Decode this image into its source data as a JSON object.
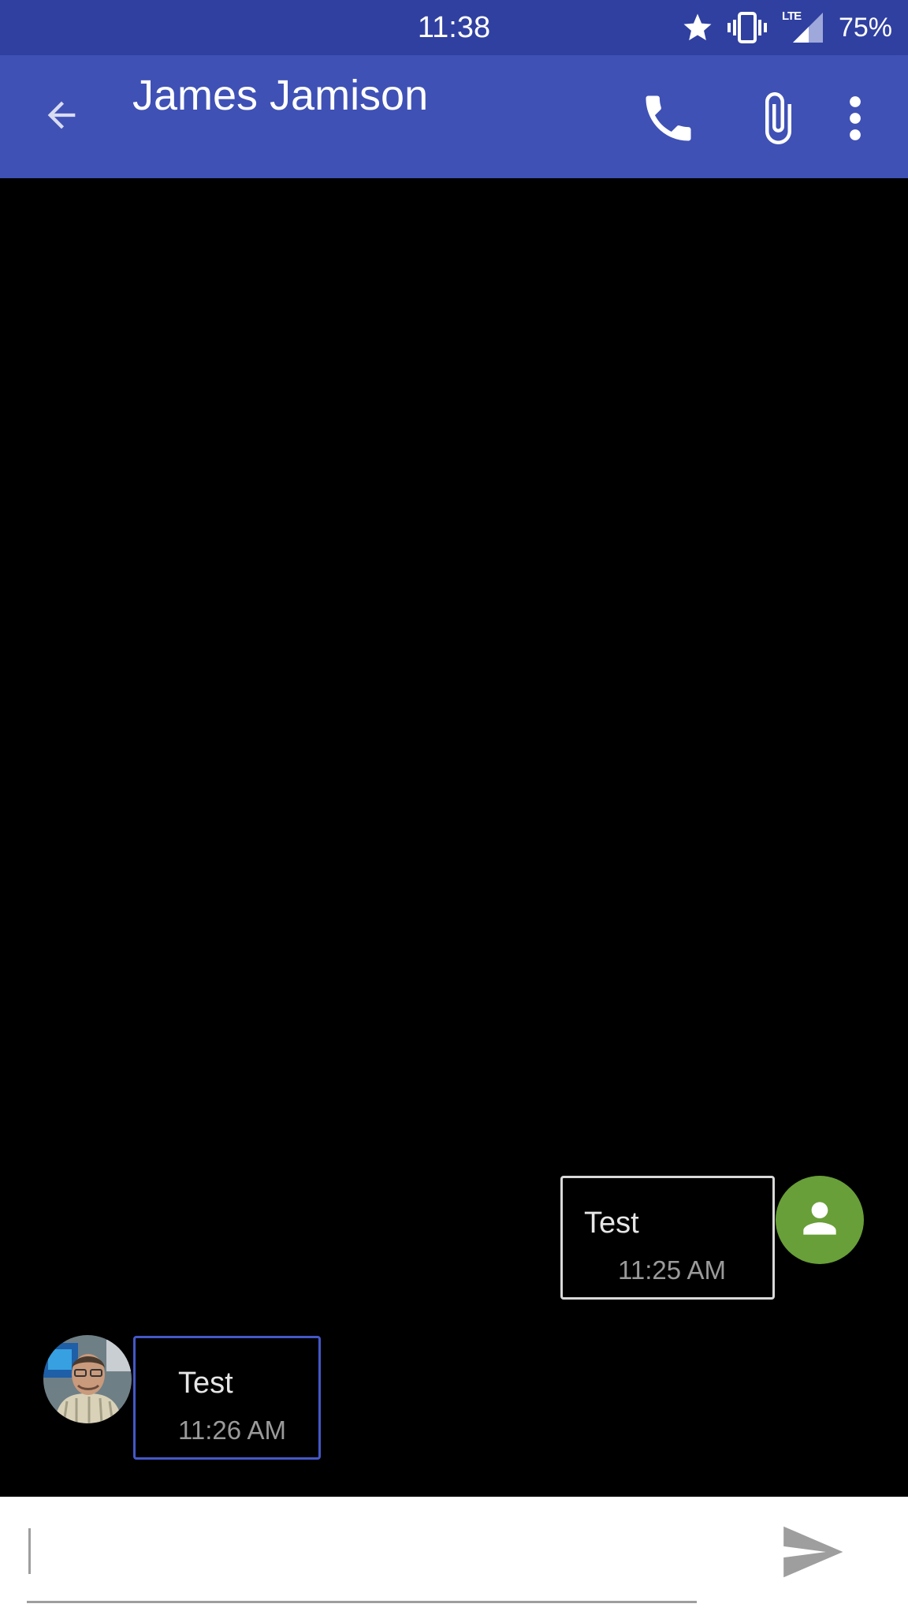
{
  "status_bar": {
    "time": "11:38",
    "network_label": "LTE",
    "battery": "75%",
    "icons": [
      "star-icon",
      "vibrate-icon",
      "lte-signal-icon"
    ]
  },
  "header": {
    "contact_name": "James Jamison",
    "icons": [
      "arrow-back-icon",
      "phone-icon",
      "paperclip-icon",
      "more-vert-icon"
    ]
  },
  "messages": [
    {
      "direction": "outgoing",
      "text": "Test",
      "time": "11:25 AM",
      "avatar": "person-icon"
    },
    {
      "direction": "incoming",
      "text": "Test",
      "time": "11:26 AM",
      "avatar": "contact-photo"
    }
  ],
  "compose": {
    "value": "",
    "send_icon": "send-icon"
  },
  "colors": {
    "status_bar": "#3040A0",
    "app_bar": "#3F51B5",
    "background": "#000000",
    "outgoing_border": "#d9d9d9",
    "incoming_border": "#4458c8",
    "avatar_green": "#689F38",
    "compose_bg": "#ffffff"
  }
}
